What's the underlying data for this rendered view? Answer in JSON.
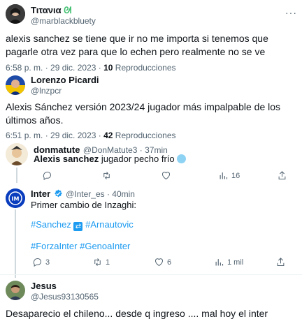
{
  "tweet1": {
    "name": "Τιτανια",
    "handle": "@marblackbluety",
    "text": "alexis sanchez se tiene que ir no me importa si tenemos que pagarle otra vez para que lo echen pero realmente no se ve",
    "time": "6:58 p. m. · 29 dic. 2023 · ",
    "views_count": "10",
    "views_label": " Reproducciones",
    "more": "···"
  },
  "tweet2": {
    "name": "Lorenzo Picardi",
    "handle": "@lnzpcr",
    "text": "Alexis Sánchez versión 2023/24 jugador más impalpable de los últimos años.",
    "time": "6:51 p. m. · 29 dic. 2023 · ",
    "views_count": "42",
    "views_label": " Reproducciones"
  },
  "tweet3": {
    "name": "donmatute",
    "handle": "@DonMatute3 · 37min",
    "text_bold": "Alexis sanchez",
    "text_rest": " jugador pecho frío",
    "views": "16"
  },
  "tweet4": {
    "name": "Inter",
    "handle": "@Inter_es · 40min",
    "line1": "Primer cambio de Inzaghi:",
    "hashtag_a": "#Sanchez",
    "hashtag_b": "#Arnautovic",
    "hashtag_c": "#ForzaInter",
    "hashtag_d": "#GenoaInter",
    "replies": "3",
    "retweets": "1",
    "likes": "6",
    "views": "1 mil"
  },
  "tweet5": {
    "name": "Jesus",
    "handle": "@Jesus93130565",
    "text": "Desaparecio el chileno... desde q ingreso .... mal hoy el inter"
  },
  "colors": {
    "link": "#1d9bf0",
    "muted": "#536471",
    "verified": "#1d9bf0",
    "border": "#eff3f4"
  }
}
